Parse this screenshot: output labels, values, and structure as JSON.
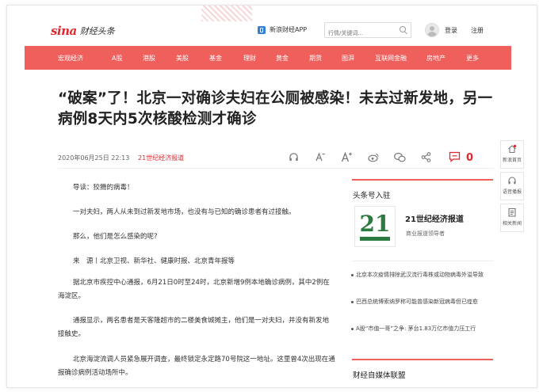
{
  "header": {
    "brand_logo": "sina",
    "brand_text": "财经头条",
    "app_link": "新浪财经APP",
    "search_placeholder": "行情/关键词...",
    "login": "登录",
    "register": "注册"
  },
  "nav": {
    "items": [
      "宏观经济",
      "A股",
      "港股",
      "美股",
      "基金",
      "理财",
      "黄金",
      "期货",
      "图湃",
      "互联网金融",
      "房地产",
      "更多"
    ]
  },
  "article": {
    "title": "“破案”了！北京一对确诊夫妇在公厕被感染！未去过新发地，另一病例8天内5次核酸检测才确诊",
    "date": "2020年06月25日 22:13",
    "source": "21世纪经济报道",
    "comment_count": "0",
    "paragraphs": [
      "导读：狡猾的病毒！",
      "一对夫妇，两人从未到过新发地市场，也没有与已知的确诊患者有过接触。",
      "那么，他们是怎么感染的呢?",
      "来　源丨北京卫视、新华社、健康时报、北京青年报等",
      "据北京市疾控中心通报，6月21日0时至24时，北京新增9例本地确诊病例，其中2例在海淀区。",
      "通报显示，两名患者是天客隆超市的二楼美食城摊主，他们是一对夫妇，并没有新发地接触史。",
      "北京海淀流调人员紧急展开调查，最终锁定永定路70号院这一地址。这里曾4次出现在通报确诊病例活动场所中。"
    ]
  },
  "sidebar": {
    "heading": "头条号入驻",
    "account_logo_text": "21",
    "account_name": "21世纪经济报道",
    "account_desc": "商业报道领导者",
    "news": [
      "北京本次疫情排除武汉流行毒株或动物病毒外溢导致",
      "巴西总统博索纳罗称可能曾感染新冠病毒但已痊愈",
      "A股“市值一哥”之争: 茅台1.83万亿市值力压工行"
    ],
    "section2_heading": "财经自媒体联盟"
  },
  "floating": {
    "items": [
      "新浪首页",
      "语音播报",
      "相关新闻"
    ]
  },
  "colors": {
    "accent": "#ef5f5c",
    "brand_red": "#e0282e",
    "logo_green": "#2b7a3f"
  }
}
